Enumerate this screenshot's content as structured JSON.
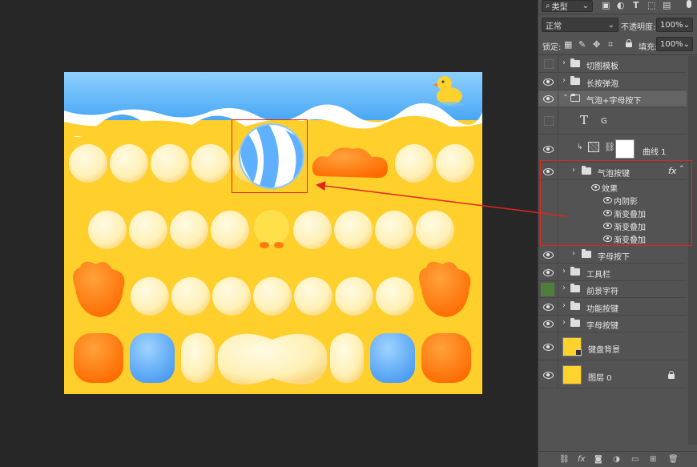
{
  "toolbar": {
    "filter_label": "类型",
    "blend_mode": "正常",
    "opacity_label": "不透明度:",
    "opacity_value": "100%",
    "lock_label": "锁定:",
    "fill_label": "填充:",
    "fill_value": "100%"
  },
  "layers": [
    {
      "name": "切图模板",
      "visible": false,
      "kind": "folder"
    },
    {
      "name": "长按弹泡",
      "visible": true,
      "kind": "folder"
    },
    {
      "name": "气泡+字母按下",
      "visible": true,
      "kind": "folder-open"
    },
    {
      "name": "G",
      "visible": false,
      "kind": "text",
      "type_glyph": "T"
    },
    {
      "name": "曲线 1",
      "visible": true,
      "kind": "adjustment"
    },
    {
      "name": "气泡按键",
      "visible": true,
      "kind": "folder",
      "fx": "fx"
    },
    {
      "name": "效果",
      "kind": "effects-header"
    },
    {
      "name": "内阴影",
      "kind": "effect"
    },
    {
      "name": "渐变叠加",
      "kind": "effect"
    },
    {
      "name": "渐变叠加",
      "kind": "effect"
    },
    {
      "name": "渐变叠加",
      "kind": "effect"
    },
    {
      "name": "字母按下",
      "visible": true,
      "kind": "folder"
    },
    {
      "name": "工具栏",
      "visible": true,
      "kind": "folder"
    },
    {
      "name": "前景字符",
      "visible": false,
      "kind": "folder"
    },
    {
      "name": "功能按键",
      "visible": true,
      "kind": "folder"
    },
    {
      "name": "字母按键",
      "visible": true,
      "kind": "folder"
    },
    {
      "name": "键盘背景",
      "visible": true,
      "kind": "smart-object"
    },
    {
      "name": "图层 0",
      "visible": true,
      "kind": "locked-layer"
    }
  ],
  "colors": {
    "accent_red": "#e0261d",
    "canvas_yellow": "#ffcf2c",
    "key_cream": "#fff0b8",
    "orange": "#ff7b0e",
    "blue": "#5fb0ff"
  }
}
